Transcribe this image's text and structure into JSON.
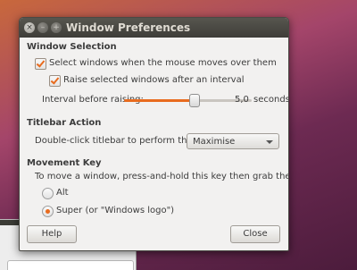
{
  "window": {
    "title": "Window Preferences",
    "close_glyph": "×",
    "minimize_glyph": "–",
    "maximize_glyph": "+"
  },
  "window_selection": {
    "heading": "Window Selection",
    "select_on_hover": {
      "label": "Select windows when the mouse moves over them",
      "checked": true
    },
    "raise_after_interval": {
      "label": "Raise selected windows after an interval",
      "checked": true
    },
    "interval": {
      "label": "Interval before raising:",
      "value": "5,0",
      "unit": "seconds",
      "fraction": 0.55
    }
  },
  "titlebar_action": {
    "heading": "Titlebar Action",
    "label": "Double-click titlebar to perform this action:",
    "selected": "Maximise"
  },
  "movement_key": {
    "heading": "Movement Key",
    "description": "To move a window, press-and-hold this key then grab the window:",
    "options": [
      {
        "label": "Alt",
        "selected": false
      },
      {
        "label": "Super (or \"Windows logo\")",
        "selected": true
      }
    ]
  },
  "buttons": {
    "help": "Help",
    "close": "Close"
  },
  "colors": {
    "accent": "#e86b1e",
    "titlebar": "#3e3d39"
  }
}
